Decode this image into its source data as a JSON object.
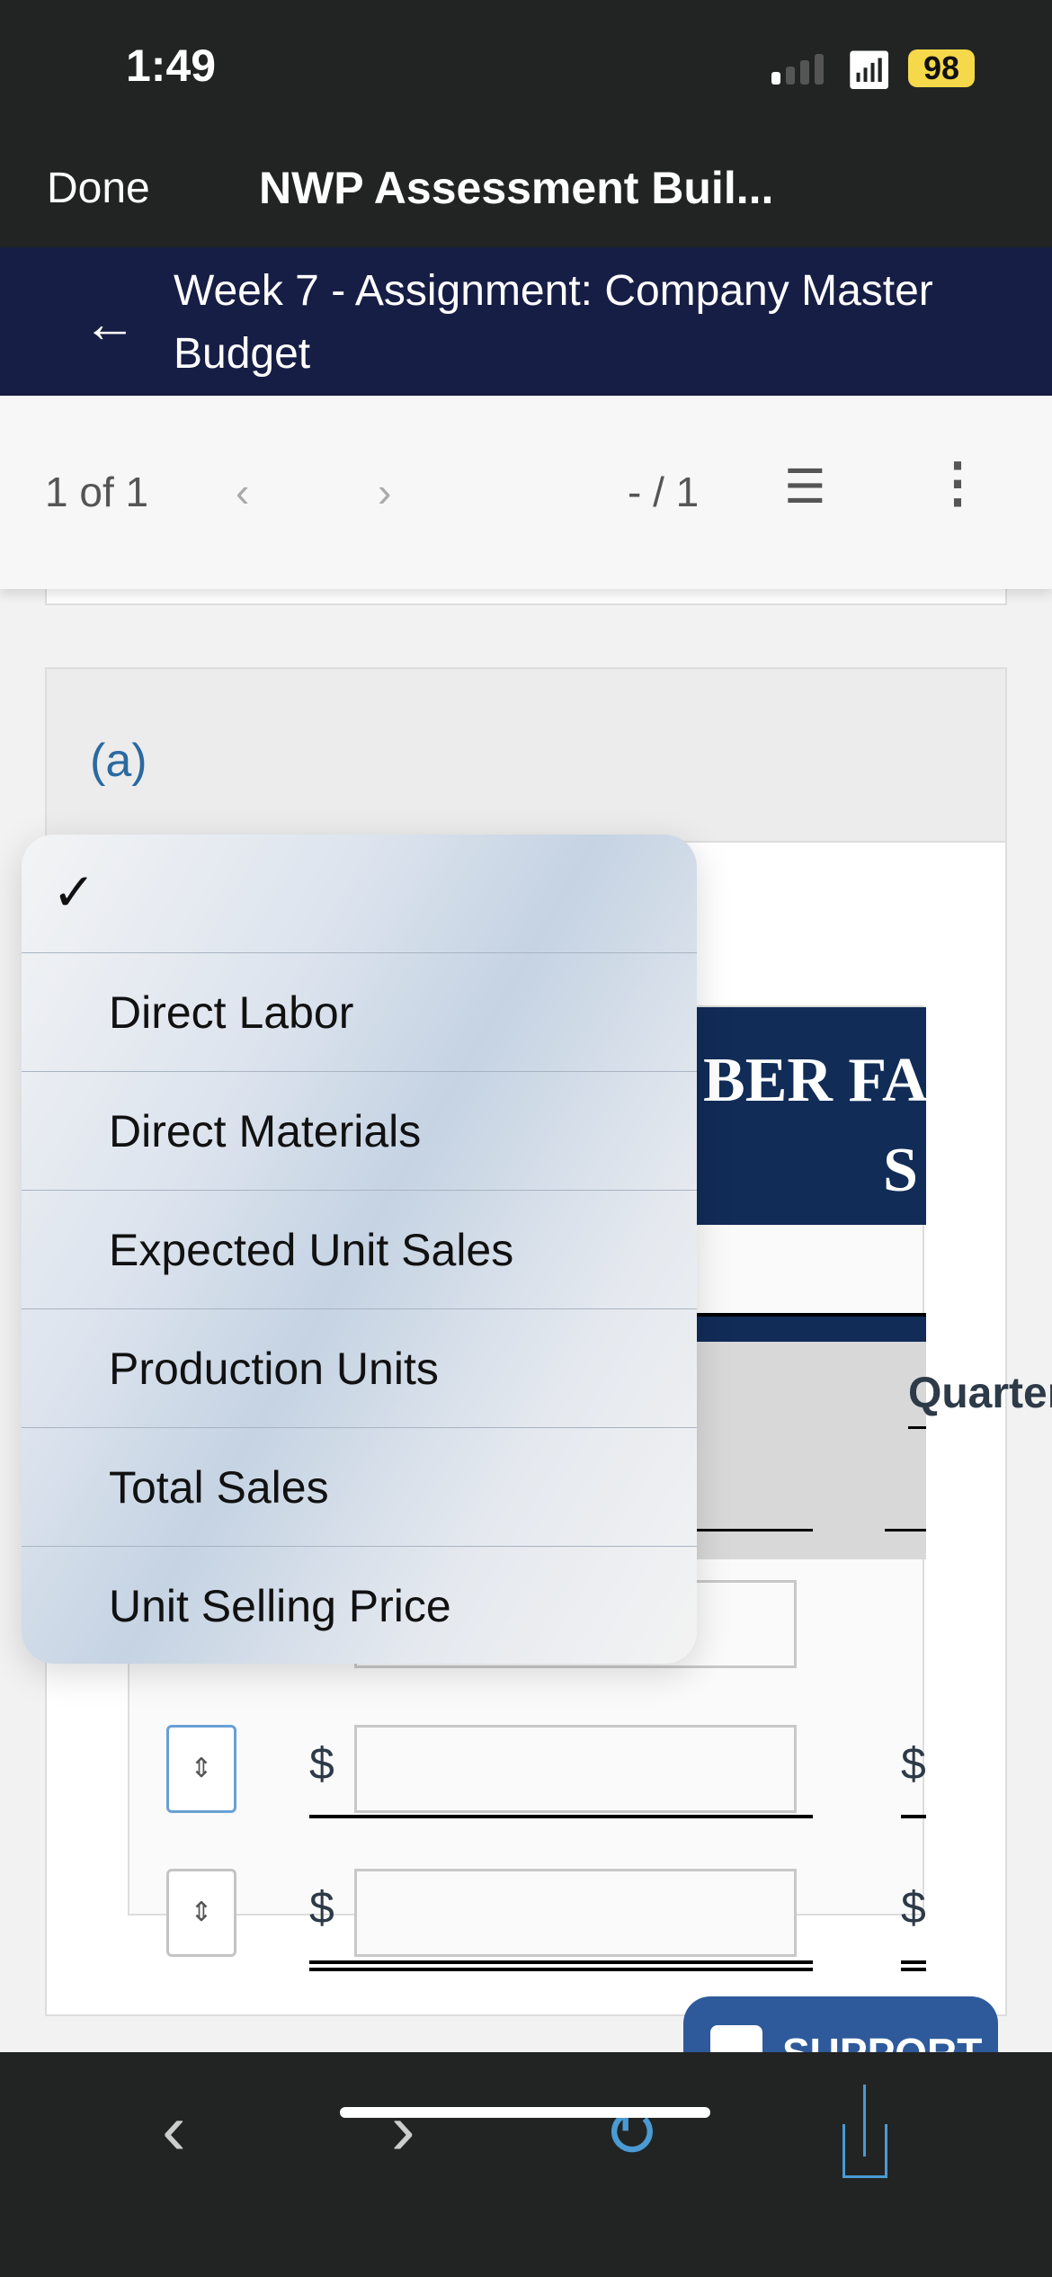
{
  "status_bar": {
    "time": "1:49",
    "battery": "98",
    "battery_color": "#f5d94a"
  },
  "nav": {
    "done_label": "Done",
    "app_title": "NWP Assessment Buil..."
  },
  "header": {
    "title": "Week 7 - Assignment: Company Master Budget",
    "back_icon": "arrow-left-icon"
  },
  "toolbar": {
    "page_of": "1 of 1",
    "page_indicator": "- / 1"
  },
  "section": {
    "label": "(a)"
  },
  "table": {
    "banner_line1": "BER FA",
    "banner_line2": "S",
    "column_header": "Quarter",
    "currency": "$"
  },
  "dropdown": {
    "selected": "",
    "options": [
      "Direct Labor",
      "Direct Materials",
      "Expected Unit Sales",
      "Production Units",
      "Total Sales",
      "Unit Selling Price"
    ]
  },
  "support": {
    "label": "SUPPORT",
    "color": "#2e5a9b"
  },
  "colors": {
    "header_navy": "#171e45",
    "table_navy": "#112c57",
    "link_blue": "#2a6aa0"
  }
}
